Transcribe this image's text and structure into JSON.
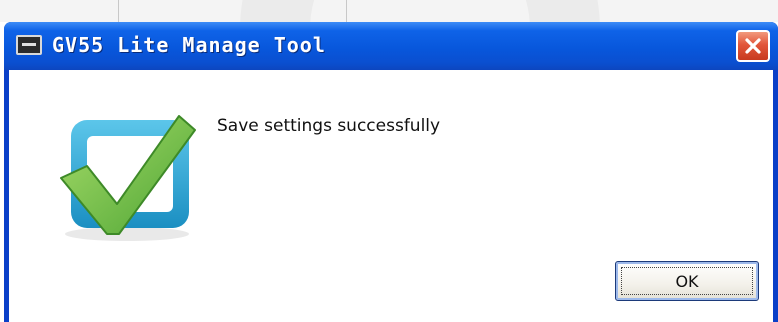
{
  "window": {
    "title": "GV55 Lite Manage Tool",
    "icons": {
      "app": "app-window-icon",
      "close": "close-icon",
      "status": "checkmark-success-icon"
    }
  },
  "dialog": {
    "message": "Save settings successfully",
    "ok_label": "OK"
  },
  "colors": {
    "titlebar": "#0857dc",
    "close_button": "#e2563a",
    "check_green": "#6cc24a",
    "check_frame": "#2aa6d6"
  }
}
